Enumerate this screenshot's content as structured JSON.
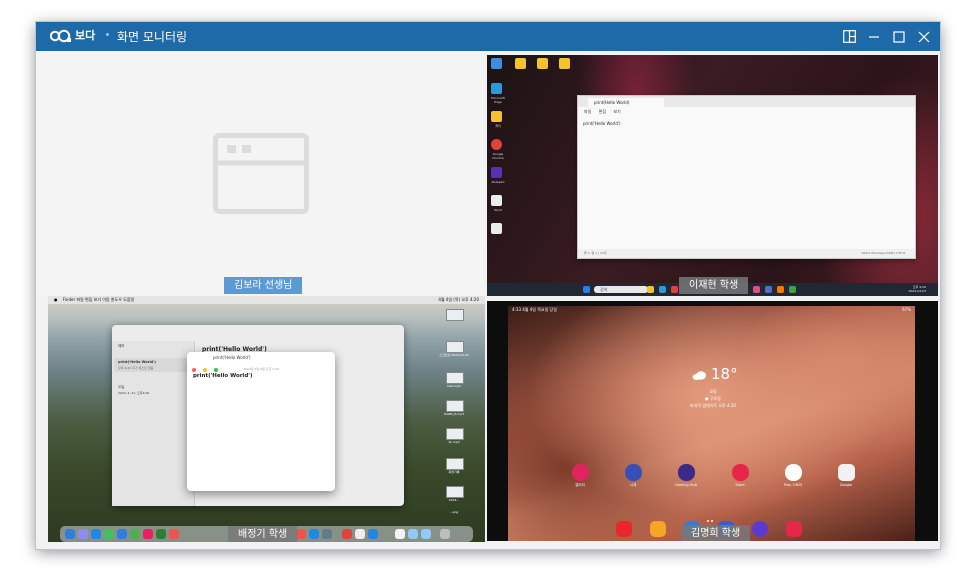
{
  "titlebar": {
    "logo_text": "보다",
    "app_title": "화면 모니터링",
    "layout_icon": "layout-icon",
    "minimize_icon": "minimize-icon",
    "maximize_icon": "maximize-icon",
    "close_icon": "close-icon",
    "bg_color": "#1e6aa9"
  },
  "panes": {
    "teacher": {
      "name": "김보라 선생님",
      "placeholder_icon": "window-placeholder-icon"
    },
    "windows": {
      "name": "이재현 학생",
      "notepad_tab": "print(Hello World)",
      "notepad_menu": [
        "파일",
        "편집",
        "보기"
      ],
      "notepad_text": "print('Hello World')",
      "status_left": "줄 1, 열 1 | 21자",
      "status_right": "100%   Windows (CRLF)   UTF-8",
      "search": "검색",
      "clock_time": "오후 4:20",
      "clock_date": "2024-04-03",
      "desktop_labels": [
        "휴지통",
        "Microsoft Edge",
        "폴더",
        "Google Chrome",
        "Notepad",
        "Word"
      ]
    },
    "mac": {
      "name": "배정기 학생",
      "menubar": "Finder  파일  편집  보기  이동  윈도우  도움말",
      "menubar_right": "4월 4일 (목) 오후 4:20",
      "finder_side_title": "메모",
      "finder_note_title": "print('Hello World')",
      "finder_note_date": "오후 4:20  추가 텍스트 없음",
      "finder_folder": "오늘",
      "finder_folder_date": "2024. 4. 21. 오후4:00",
      "finder_heading": "print('Hello World')",
      "editor_title": "print('Hello World')",
      "editor_date": "2024년 4월 4일 오후 4:20",
      "editor_text": "print('Hello World')",
      "right_labels": [
        "스크린샷 2024-04-04",
        "test.mp4",
        "HAND_R.mp4",
        "4k.mp4",
        "화면기록",
        "2024...",
        "...png"
      ]
    },
    "android": {
      "name": "김명희 학생",
      "status_left": "4:33  4월 4일 목요일  당일",
      "status_right": "67%",
      "temperature": "18°",
      "weather_desc": "흐림",
      "weather_loc": "● 구로동",
      "weather_time": "마지막 업데이트 오후 4:20",
      "apps": [
        {
          "label": "갤러리",
          "color": "#e0245e"
        },
        {
          "label": "시계",
          "color": "#3a4fb5"
        },
        {
          "label": "Gaming Hub",
          "color": "#3b2a8c"
        },
        {
          "label": "Store",
          "color": "#e6264a"
        },
        {
          "label": "Play 스토어",
          "color": "#ffffff"
        },
        {
          "label": "Google",
          "color": "#f1f1f1"
        }
      ],
      "dock_colors": [
        "#e8262d",
        "#f5a623",
        "#2f7de1",
        "#2f62d8",
        "#5b3ad1",
        "#e6264a"
      ]
    }
  }
}
